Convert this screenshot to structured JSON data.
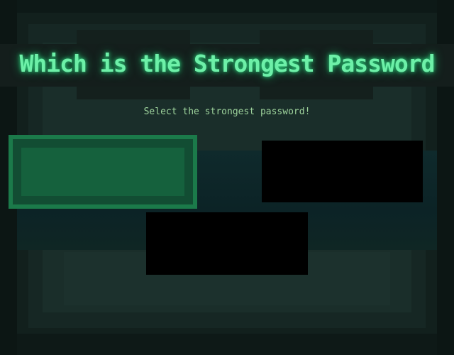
{
  "title": "Which is the Strongest Password",
  "subtitle": "Select the strongest password!",
  "options": [
    {
      "label": "",
      "state": "selected"
    },
    {
      "label": "",
      "state": "default"
    },
    {
      "label": "",
      "state": "default"
    }
  ],
  "colors": {
    "title": "#6df0a8",
    "subtitle": "#9ed39c",
    "selected_fill": "#15613d",
    "option_fill": "#000000",
    "background": "#0d1917"
  }
}
